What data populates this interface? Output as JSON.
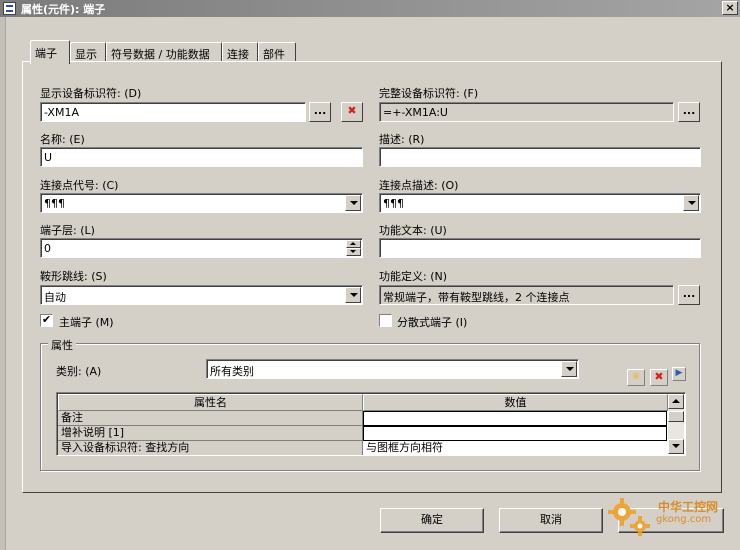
{
  "window": {
    "title": "属性(元件): 端子",
    "close_label": "×"
  },
  "tabs": [
    {
      "label": "端子",
      "active": true
    },
    {
      "label": "显示",
      "active": false
    },
    {
      "label": "符号数据 / 功能数据",
      "active": false
    },
    {
      "label": "连接",
      "active": false
    },
    {
      "label": "部件",
      "active": false
    }
  ],
  "fields": {
    "display_dt": {
      "label": "显示设备标识符: (D)",
      "value": "-XM1A"
    },
    "full_dt": {
      "label": "完整设备标识符: (F)",
      "value": "=+-XM1A:U"
    },
    "name": {
      "label": "名称: (E)",
      "value": "U"
    },
    "description": {
      "label": "描述: (R)",
      "value": ""
    },
    "conn_code": {
      "label": "连接点代号: (C)",
      "value": "¶¶¶"
    },
    "conn_desc": {
      "label": "连接点描述: (O)",
      "value": "¶¶¶"
    },
    "terminal_level": {
      "label": "端子层: (L)",
      "value": "0"
    },
    "function_text": {
      "label": "功能文本: (U)",
      "value": ""
    },
    "saddle_jumper": {
      "label": "鞍形跳线: (S)",
      "value": "自动"
    },
    "function_def": {
      "label": "功能定义: (N)",
      "value": "常规端子，带有鞍型跳线，2 个连接点"
    }
  },
  "checkboxes": {
    "main_terminal": {
      "label": "主端子 (M)",
      "checked": true,
      "mark": "✔"
    },
    "distributed_terminal": {
      "label": "分散式端子 (I)",
      "checked": false,
      "mark": ""
    }
  },
  "properties": {
    "group_title": "属性",
    "category_label": "类别: (A)",
    "category_value": "所有类别",
    "columns": [
      "属性名",
      "数值"
    ],
    "rows": [
      {
        "name": "备注",
        "value": ""
      },
      {
        "name": "增补说明 [1]",
        "value": ""
      },
      {
        "name": "导入设备标识符: 查找方向",
        "value": "与图框方向相符"
      }
    ]
  },
  "buttons": {
    "ellipsis": "...",
    "delete_x": "✖",
    "new_star": "✳",
    "play": "▶",
    "ok": "确定",
    "cancel": "取消"
  },
  "watermark": {
    "line1": "中华工控网",
    "line2": "gkong.com"
  },
  "colors": {
    "titlebar": "#8a8a8a",
    "delete_red": "#d9201a",
    "new_yellow": "#e7b81c",
    "watermark": "#d9861a"
  }
}
